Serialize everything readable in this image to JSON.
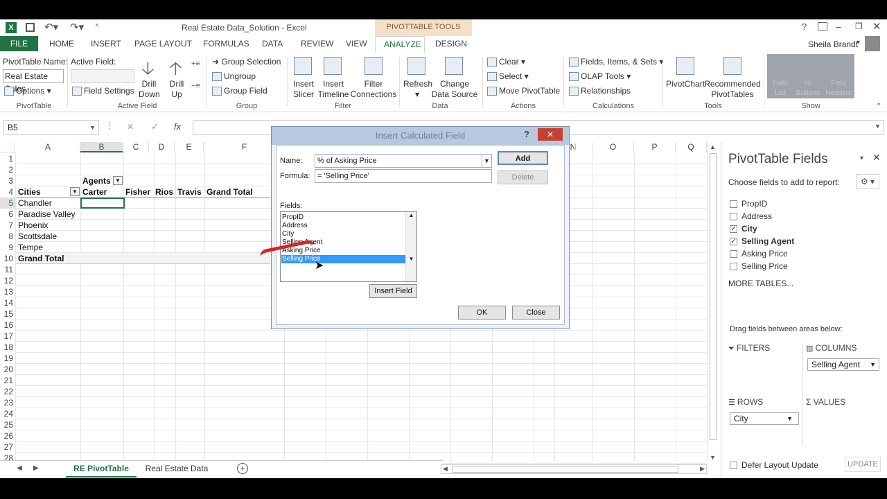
{
  "window": {
    "title": "Real Estate Data_Solution - Excel",
    "contextual_tab_group": "PIVOTTABLE TOOLS",
    "user": "Sheila Brandt"
  },
  "tabs": [
    "FILE",
    "HOME",
    "INSERT",
    "PAGE LAYOUT",
    "FORMULAS",
    "DATA",
    "REVIEW",
    "VIEW",
    "ANALYZE",
    "DESIGN"
  ],
  "ribbon": {
    "pivottable": {
      "name_label": "PivotTable Name:",
      "name_value": "Real Estate Sales",
      "options": "Options",
      "group": "PivotTable"
    },
    "active_field": {
      "label": "Active Field:",
      "field_settings": "Field Settings",
      "drill_down": "Drill Down",
      "drill_up": "Drill Up",
      "group": "Active Field"
    },
    "group": {
      "group_selection": "Group Selection",
      "ungroup": "Ungroup",
      "group_field": "Group Field",
      "group": "Group"
    },
    "filter": {
      "insert_slicer": "Insert Slicer",
      "insert_timeline": "Insert Timeline",
      "filter_connections": "Filter Connections",
      "group": "Filter"
    },
    "data": {
      "refresh": "Refresh",
      "change_data_source": "Change Data Source",
      "group": "Data"
    },
    "actions": {
      "clear": "Clear",
      "select": "Select",
      "move_pivottable": "Move PivotTable",
      "group": "Actions"
    },
    "calculations": {
      "fields_items_sets": "Fields, Items, & Sets",
      "olap_tools": "OLAP Tools",
      "relationships": "Relationships",
      "group": "Calculations"
    },
    "tools": {
      "pivotchart": "PivotChart",
      "recommended": "Recommended PivotTables",
      "group": "Tools"
    },
    "show": {
      "field_list": "Field List",
      "buttons": "+/- Buttons",
      "headers": "Field Headers",
      "group": "Show"
    }
  },
  "formula_bar": {
    "name_box": "B5",
    "cancel": "✕",
    "enter": "✓",
    "fx": "fx",
    "value": ""
  },
  "columns_left": [
    "A",
    "B",
    "C",
    "D",
    "E",
    "F"
  ],
  "columns_right": [
    "N",
    "O",
    "P",
    "Q"
  ],
  "rows": [
    "1",
    "2",
    "3",
    "4",
    "5",
    "6",
    "7",
    "8",
    "9",
    "10",
    "11",
    "12",
    "13",
    "14",
    "15",
    "16",
    "17",
    "18",
    "19",
    "20",
    "21",
    "22",
    "23",
    "24",
    "25",
    "26",
    "27",
    "28"
  ],
  "pivot": {
    "agents_label": "Agents",
    "cities_label": "Cities",
    "agents": [
      "Carter",
      "Fisher",
      "Rios",
      "Travis",
      "Grand Total"
    ],
    "cities": [
      "Chandler",
      "Paradise Valley",
      "Phoenix",
      "Scottsdale",
      "Tempe"
    ],
    "grand_total": "Grand Total"
  },
  "sheet_tabs": [
    "RE PivotTable",
    "Real Estate Data"
  ],
  "dialog": {
    "title": "Insert Calculated Field",
    "name_label": "Name:",
    "name_value": "% of Asking Price",
    "formula_label": "Formula:",
    "formula_value": "= 'Selling Price'",
    "add": "Add",
    "delete": "Delete",
    "fields_label": "Fields:",
    "fields": [
      "PropID",
      "Address",
      "City",
      "Selling Agent",
      "Asking Price",
      "Selling Price"
    ],
    "selected_field": "Selling Price",
    "insert_field": "Insert Field",
    "ok": "OK",
    "close": "Close"
  },
  "field_panel": {
    "title": "PivotTable Fields",
    "subtitle": "Choose fields to add to report:",
    "fields": [
      {
        "name": "PropID",
        "checked": false
      },
      {
        "name": "Address",
        "checked": false
      },
      {
        "name": "City",
        "checked": true
      },
      {
        "name": "Selling Agent",
        "checked": true
      },
      {
        "name": "Asking Price",
        "checked": false
      },
      {
        "name": "Selling Price",
        "checked": false
      }
    ],
    "more_tables": "MORE TABLES...",
    "drag_label": "Drag fields between areas below:",
    "filters": "FILTERS",
    "columns": "COLUMNS",
    "columns_item": "Selling Agent",
    "rows": "ROWS",
    "rows_item": "City",
    "values": "VALUES",
    "defer": "Defer Layout Update",
    "update": "UPDATE"
  },
  "colors": {
    "file_tab": "#217346",
    "accent": "#217346",
    "selection": "#3399ff",
    "contextual": "#f2e0c9"
  }
}
